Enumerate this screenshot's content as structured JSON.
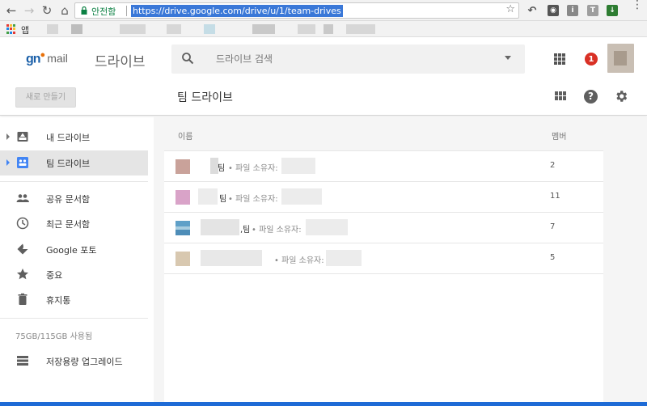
{
  "browser": {
    "secure_label": "안전함",
    "url": "https://drive.google.com/drive/u/1/team-drives",
    "bookmarks_apps_label": "앱"
  },
  "header": {
    "logo_gn": "gn",
    "logo_mail": "mail",
    "product_name": "드라이브",
    "search_placeholder": "드라이브 검색",
    "notification_count": "1",
    "new_button_label": "새로 만들기",
    "page_title": "팀 드라이브",
    "help_glyph": "?"
  },
  "sidebar": {
    "items": [
      {
        "label": "내 드라이브",
        "icon": "drive-icon"
      },
      {
        "label": "팀 드라이브",
        "icon": "team-drive-icon"
      },
      {
        "label": "공유 문서함",
        "icon": "shared-icon"
      },
      {
        "label": "최근 문서함",
        "icon": "clock-icon"
      },
      {
        "label": "Google 포토",
        "icon": "photos-icon"
      },
      {
        "label": "중요",
        "icon": "star-icon"
      },
      {
        "label": "휴지통",
        "icon": "trash-icon"
      }
    ],
    "storage": "75GB/115GB 사용됨",
    "upgrade_label": "저장용량 업그레이드"
  },
  "list": {
    "column_name": "이름",
    "column_members": "멤버",
    "rows": [
      {
        "name": "팀",
        "owner": "• 파일 소유자:",
        "members": "2"
      },
      {
        "name": "팀",
        "owner": "• 파일 소유자:",
        "members": "11"
      },
      {
        "name": ",팀",
        "owner": "• 파일 소유자:",
        "members": "7"
      },
      {
        "name": "",
        "owner": "• 파일 소유자:",
        "members": "5"
      }
    ]
  },
  "colors": {
    "accent_blue": "#4285f4",
    "badge_red": "#d93025",
    "url_highlight": "#3a78d8"
  }
}
